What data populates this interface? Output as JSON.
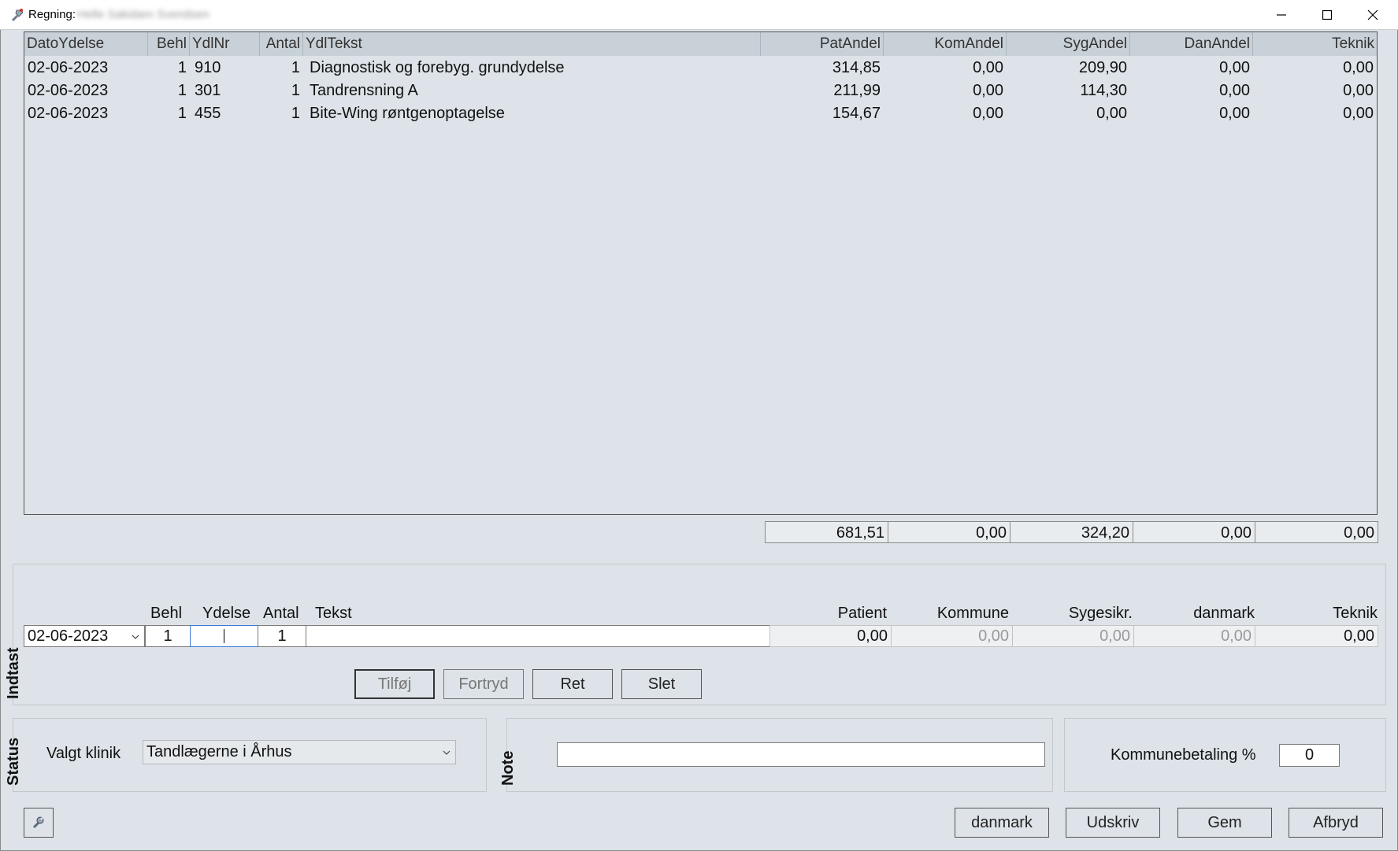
{
  "window": {
    "title_label": "Regning:",
    "title_name": "Helle Sakidam Svendsen"
  },
  "grid": {
    "columns": [
      "DatoYdelse",
      "Behl",
      "YdlNr",
      "Antal",
      "YdlTekst",
      "PatAndel",
      "KomAndel",
      "SygAndel",
      "DanAndel",
      "Teknik"
    ],
    "rows": [
      [
        "02-06-2023",
        "1",
        "910",
        "1",
        "Diagnostisk og forebyg. grundydelse",
        "314,85",
        "0,00",
        "209,90",
        "0,00",
        "0,00"
      ],
      [
        "02-06-2023",
        "1",
        "301",
        "1",
        "Tandrensning A",
        "211,99",
        "0,00",
        "114,30",
        "0,00",
        "0,00"
      ],
      [
        "02-06-2023",
        "1",
        "455",
        "1",
        "Bite-Wing røntgenoptagelse",
        "154,67",
        "0,00",
        "0,00",
        "0,00",
        "0,00"
      ]
    ]
  },
  "totals": [
    "681,51",
    "0,00",
    "324,20",
    "0,00",
    "0,00"
  ],
  "indtast": {
    "group_label": "Indtast",
    "headers": {
      "behl": "Behl",
      "ydelse": "Ydelse",
      "antal": "Antal",
      "tekst": "Tekst",
      "patient": "Patient",
      "kommune": "Kommune",
      "sygesikr": "Sygesikr.",
      "danmark": "danmark",
      "teknik": "Teknik"
    },
    "values": {
      "date": "02-06-2023",
      "behl": "1",
      "ydelse": "",
      "antal": "1",
      "tekst": "",
      "patient": "0,00",
      "kommune": "0,00",
      "sygesikr": "0,00",
      "danmark": "0,00",
      "teknik": "0,00"
    },
    "buttons": {
      "tilfoj": "Tilføj",
      "fortryd": "Fortryd",
      "ret": "Ret",
      "slet": "Slet"
    }
  },
  "status": {
    "group_label": "Status",
    "klinik_label": "Valgt klinik",
    "klinik_value": "Tandlægerne i Århus"
  },
  "note": {
    "group_label": "Note",
    "value": ""
  },
  "kommune": {
    "label": "Kommunebetaling %",
    "value": "0"
  },
  "footer": {
    "danmark": "danmark",
    "udskriv": "Udskriv",
    "gem": "Gem",
    "afbryd": "Afbryd"
  },
  "icons": [
    "app-icon",
    "minimize-icon",
    "maximize-icon",
    "close-icon",
    "chevron-down-icon",
    "tool-icon"
  ]
}
